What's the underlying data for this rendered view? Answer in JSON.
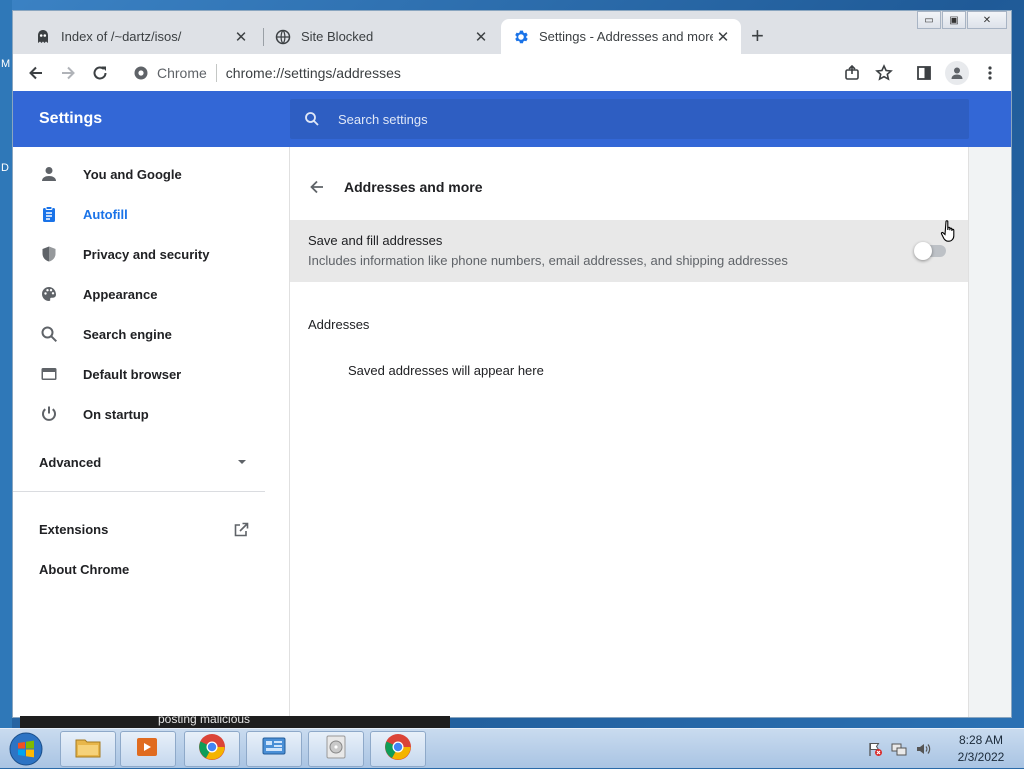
{
  "desktop": {
    "edge_text": [
      "M",
      "D"
    ]
  },
  "window": {
    "controls": {
      "minimize": "▭",
      "maximize": "▣",
      "close": "✕"
    },
    "tabs": [
      {
        "title": "Index of /~dartz/isos/",
        "icon": "ghost-favicon",
        "active": false
      },
      {
        "title": "Site Blocked",
        "icon": "globe-favicon",
        "active": false
      },
      {
        "title": "Settings - Addresses and more",
        "icon": "settings-gear-favicon",
        "active": true
      }
    ],
    "tab_close": "✕",
    "new_tab": "+"
  },
  "toolbar": {
    "chip": "Chrome",
    "url": "chrome://settings/addresses"
  },
  "settings": {
    "brand": "Settings",
    "search_placeholder": "Search settings",
    "nav": [
      {
        "label": "You and Google",
        "icon": "person-icon"
      },
      {
        "label": "Autofill",
        "icon": "clipboard-icon",
        "active": true
      },
      {
        "label": "Privacy and security",
        "icon": "shield-icon"
      },
      {
        "label": "Appearance",
        "icon": "palette-icon"
      },
      {
        "label": "Search engine",
        "icon": "search-icon"
      },
      {
        "label": "Default browser",
        "icon": "browser-icon"
      },
      {
        "label": "On startup",
        "icon": "power-icon"
      }
    ],
    "advanced": "Advanced",
    "extensions": "Extensions",
    "about": "About Chrome"
  },
  "page": {
    "title": "Addresses and more",
    "save_fill": {
      "label": "Save and fill addresses",
      "sublabel": "Includes information like phone numbers, email addresses, and shipping addresses",
      "enabled": false
    },
    "section": "Addresses",
    "empty": "Saved addresses will appear here"
  },
  "background_window": {
    "text": "posting malicious"
  },
  "taskbar": {
    "time": "8:28 AM",
    "date": "2/3/2022"
  },
  "colors": {
    "header": "#3367d6",
    "search": "#2e5ec2",
    "accent": "#1a73e8"
  }
}
